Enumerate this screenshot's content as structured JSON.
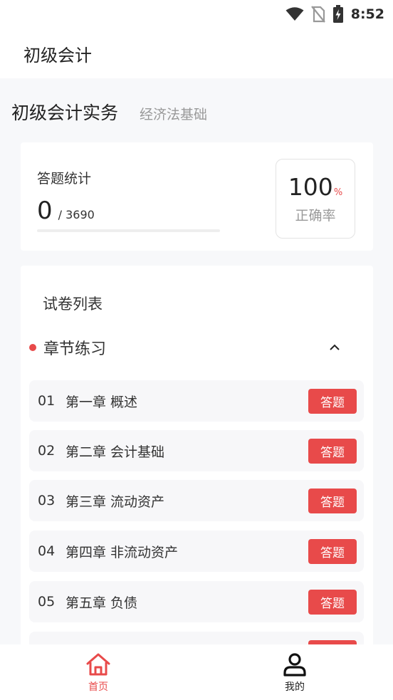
{
  "status_bar": {
    "time": "8:52"
  },
  "header": {
    "title": "初级会计"
  },
  "subjects": {
    "active": "初级会计实务",
    "inactive": "经济法基础"
  },
  "stats": {
    "label": "答题统计",
    "answered": "0",
    "total": "/ 3690",
    "progress_fraction": 0,
    "accuracy_value": "100",
    "accuracy_unit": "%",
    "accuracy_label": "正确率"
  },
  "papers": {
    "title": "试卷列表",
    "section_title": "章节练习",
    "chapters": [
      {
        "num": "01",
        "title": "第一章 概述",
        "action": "答题"
      },
      {
        "num": "02",
        "title": "第二章 会计基础",
        "action": "答题"
      },
      {
        "num": "03",
        "title": "第三章 流动资产",
        "action": "答题"
      },
      {
        "num": "04",
        "title": "第四章 非流动资产",
        "action": "答题"
      },
      {
        "num": "05",
        "title": "第五章 负债",
        "action": "答题"
      },
      {
        "num": "",
        "title": "",
        "action": ""
      }
    ]
  },
  "tabs": {
    "home": "首页",
    "mine": "我的"
  },
  "colors": {
    "accent": "#e84a4a"
  }
}
